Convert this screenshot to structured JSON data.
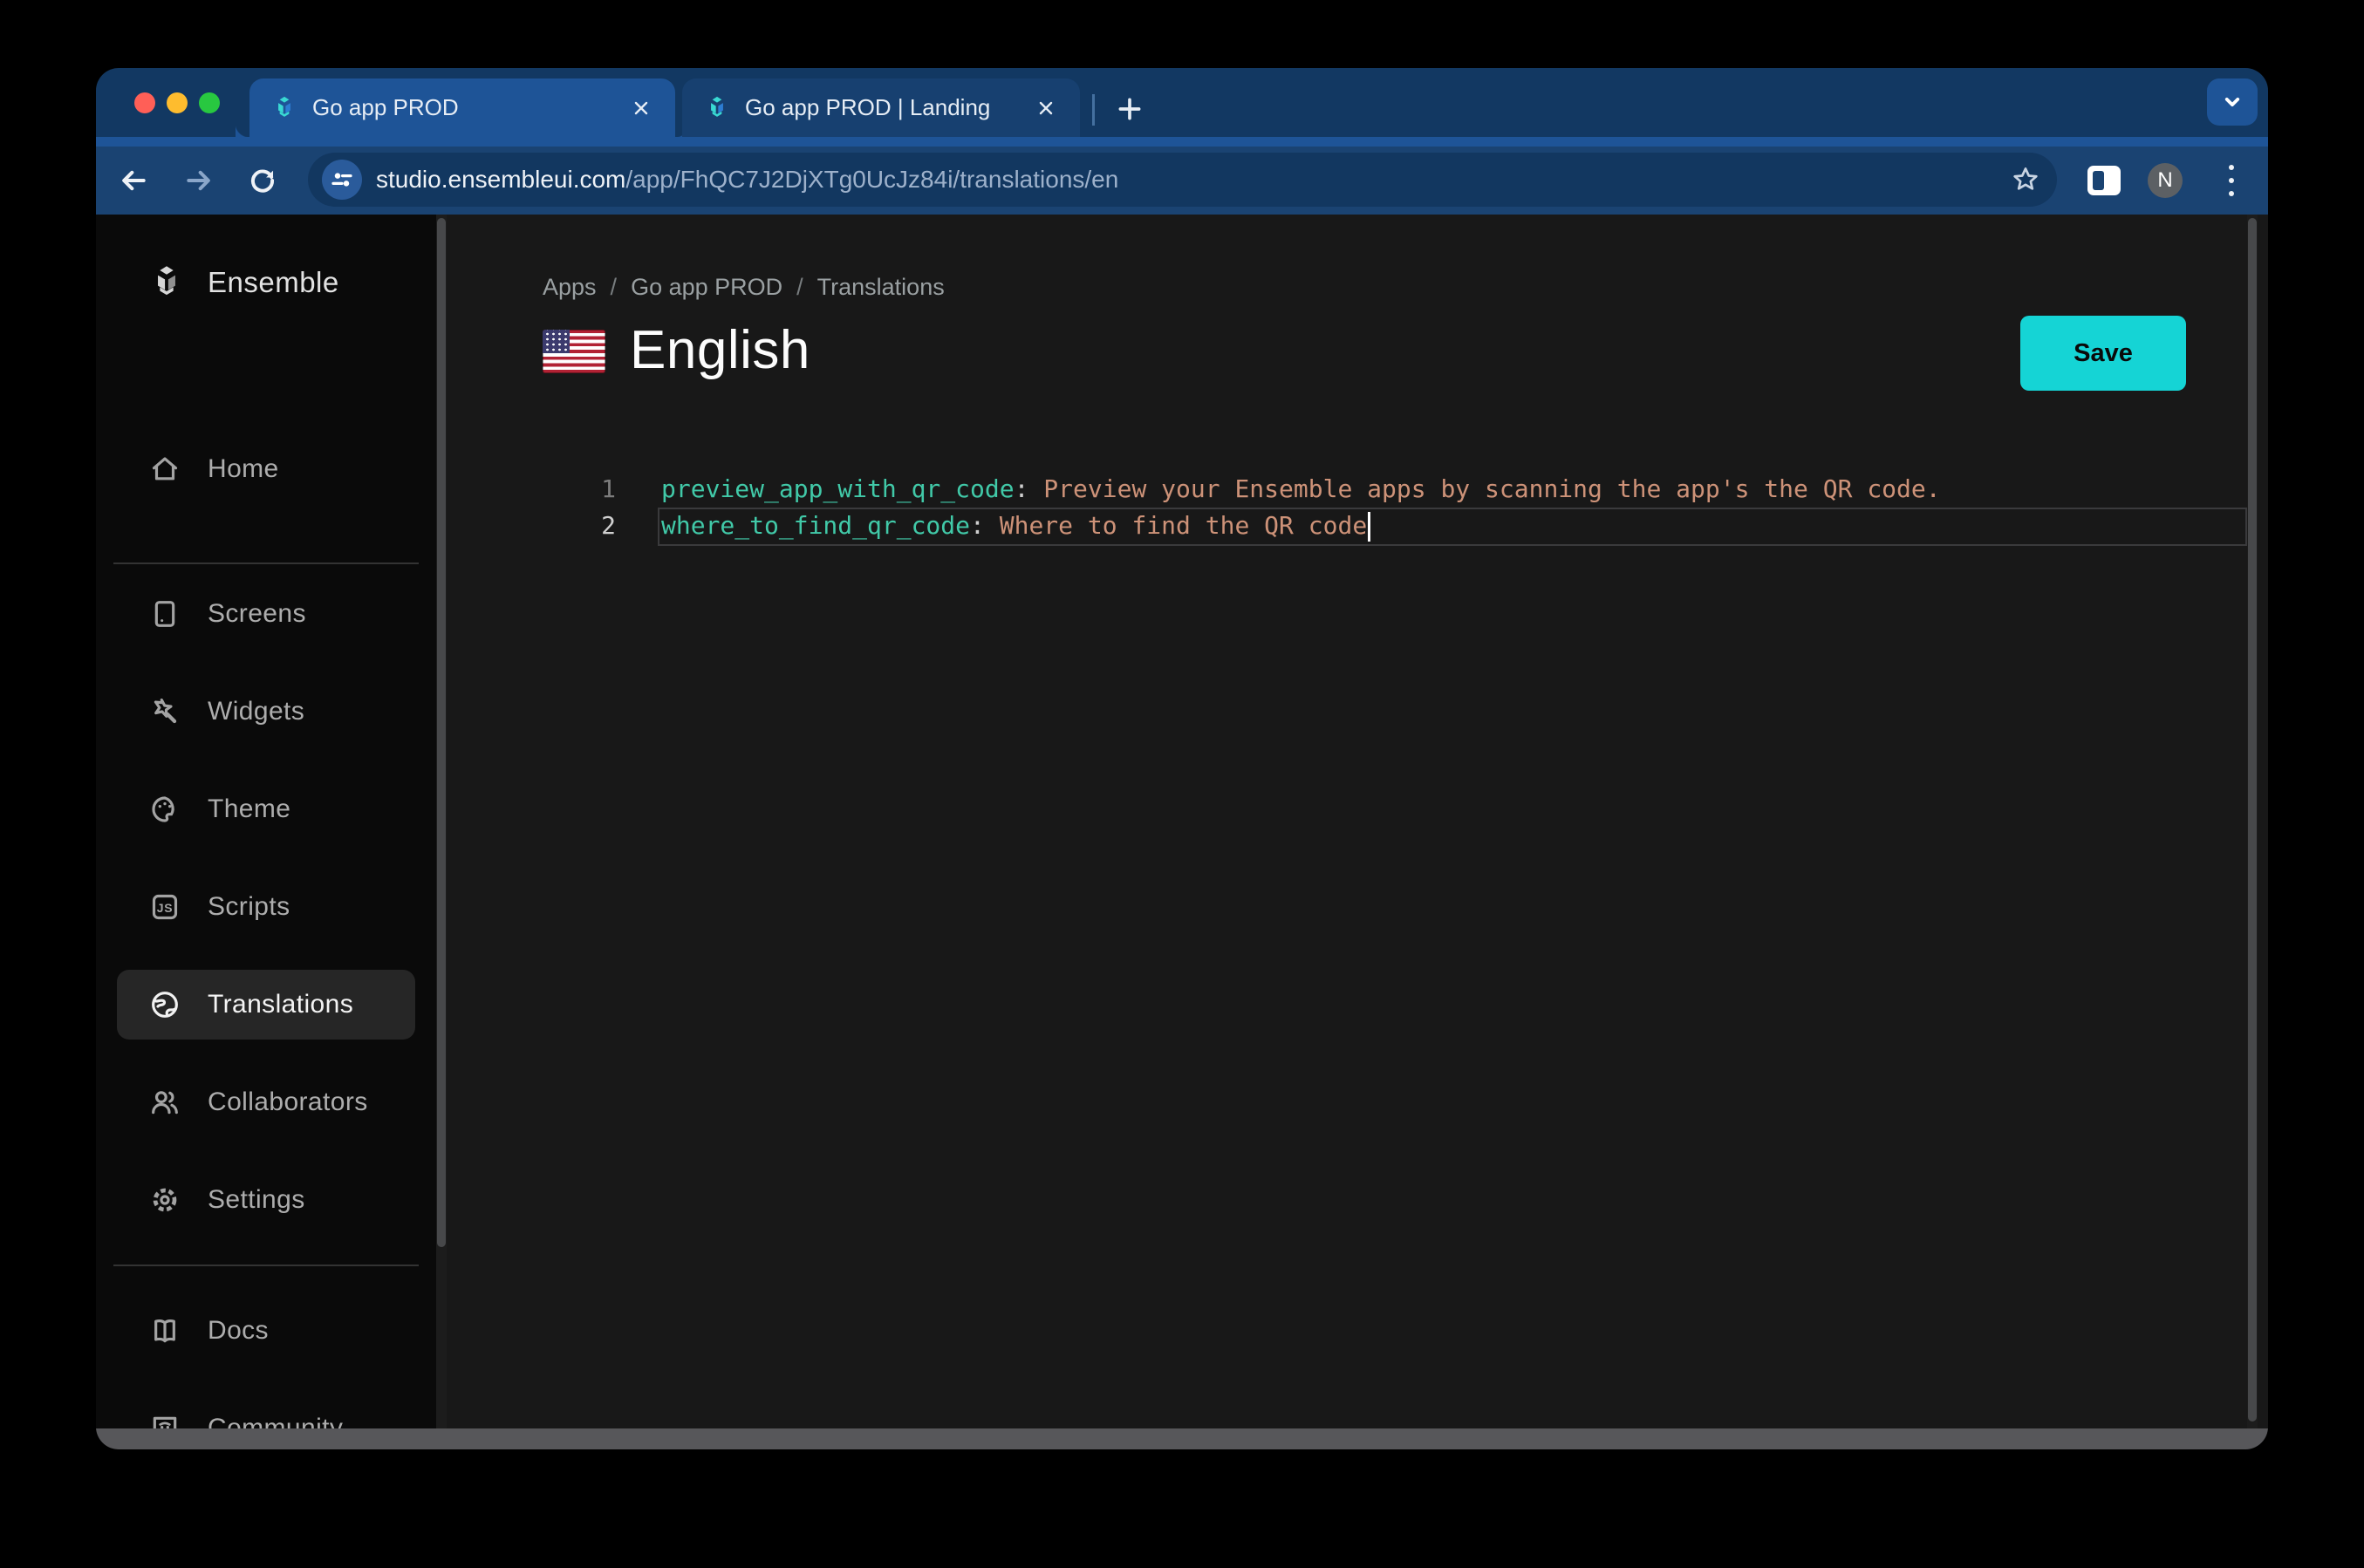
{
  "browser": {
    "tabs": [
      {
        "title": "Go app PROD"
      },
      {
        "title": "Go app PROD | Landing"
      }
    ],
    "url": {
      "host": "studio.ensembleui.com",
      "path": "/app/FhQC7J2DjXTg0UcJz84i/translations/en"
    },
    "avatar": "N"
  },
  "sidebar": {
    "brand": "Ensemble",
    "items": [
      {
        "label": "Home",
        "icon": "home-icon"
      },
      {
        "label": "Screens",
        "icon": "screens-icon"
      },
      {
        "label": "Widgets",
        "icon": "widgets-icon"
      },
      {
        "label": "Theme",
        "icon": "theme-icon"
      },
      {
        "label": "Scripts",
        "icon": "scripts-icon"
      },
      {
        "label": "Translations",
        "icon": "translations-globe-icon",
        "active": true
      },
      {
        "label": "Collaborators",
        "icon": "collaborators-icon"
      },
      {
        "label": "Settings",
        "icon": "settings-gear-icon"
      },
      {
        "label": "Docs",
        "icon": "docs-book-icon"
      },
      {
        "label": "Community",
        "icon": "community-discord-icon"
      }
    ]
  },
  "main": {
    "breadcrumb": [
      {
        "label": "Apps"
      },
      {
        "label": "Go app PROD"
      },
      {
        "label": "Translations"
      }
    ],
    "breadcrumb_sep": "/",
    "flag": "us-flag-icon",
    "title": "English",
    "save_label": "Save"
  },
  "editor": {
    "lines": [
      {
        "num": "1",
        "key": "preview_app_with_qr_code",
        "sep": ": ",
        "value": "Preview your Ensemble apps by scanning the app's the QR code."
      },
      {
        "num": "2",
        "key": "where_to_find_qr_code",
        "sep": ": ",
        "value": "Where to find the QR code"
      }
    ]
  },
  "colors": {
    "accent_cyan": "#15d4d5",
    "frame_blue": "#123862",
    "toolbar_blue": "#1a4372",
    "active_tab_blue": "#1e5497",
    "yaml_key": "#41c9a8",
    "yaml_value": "#cd9278",
    "sidebar_bg": "#0a0a0a",
    "content_bg": "#181818"
  }
}
